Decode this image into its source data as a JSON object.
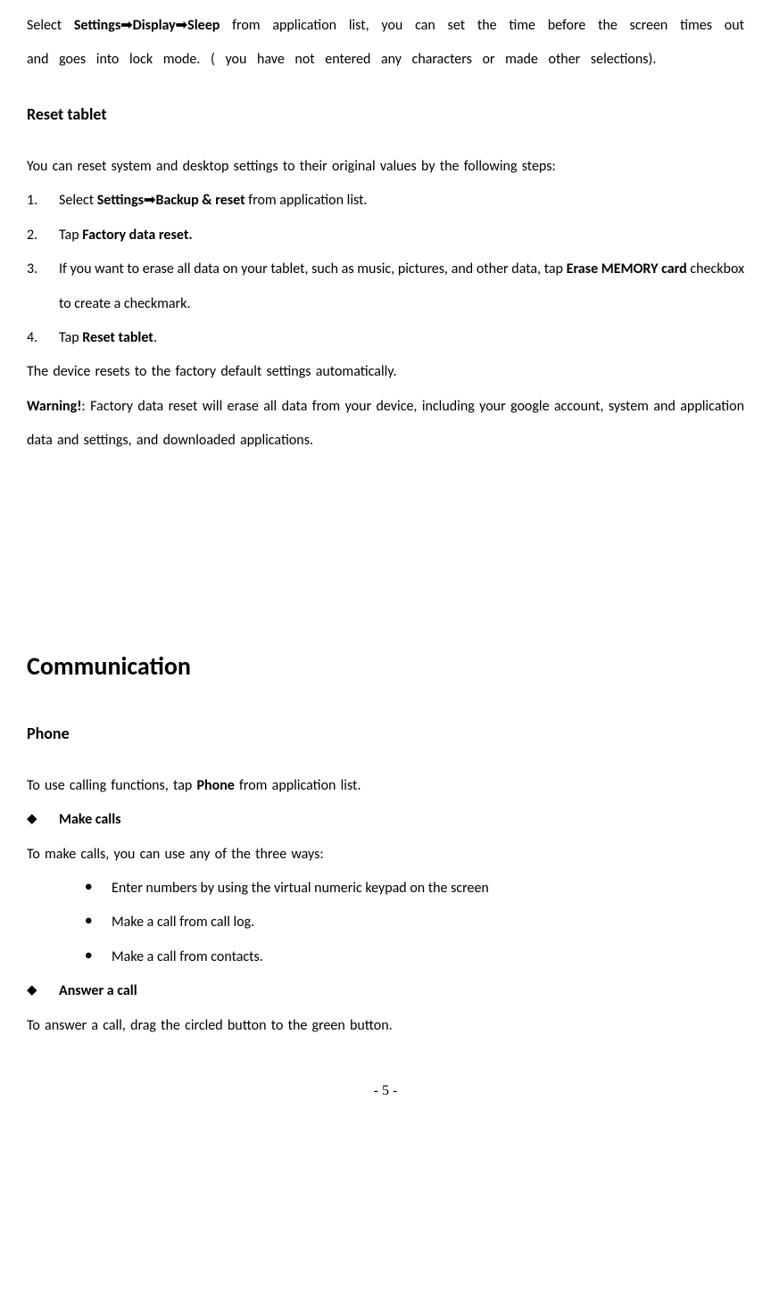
{
  "para1": {
    "pre": "Select ",
    "settings": "Settings",
    "display": "Display",
    "sleep": "Sleep",
    "post": " from application list, you can set the time before the screen times out and goes into lock mode. ( you have not entered any characters or made other selections)."
  },
  "heading_reset": "Reset tablet",
  "reset_intro": "You can reset system and desktop settings to their original values by the following steps:",
  "steps": {
    "s1": {
      "num": "1.",
      "pre": "Select ",
      "bold": "Settings",
      "mid": "Backup & reset",
      "post": " from application list."
    },
    "s2": {
      "num": "2.",
      "pre": "Tap ",
      "bold": "Factory data reset."
    },
    "s3": {
      "num": "3.",
      "pre": "If you want to erase all data on your tablet, such as music, pictures, and other data, tap ",
      "bold1": "Erase MEMORY card",
      "post": " checkbox to create a checkmark."
    },
    "s4": {
      "num": "4.",
      "pre": "Tap ",
      "bold": "Reset tablet",
      "post": "."
    }
  },
  "reset_outro": "The device resets to the factory default settings automatically.",
  "warning": {
    "label": "Warning!",
    "text": ": Factory data reset will erase all data from your device, including your google account, system and application data and settings, and downloaded applications."
  },
  "heading_comm": "Communication",
  "heading_phone": "Phone",
  "phone_intro_pre": "To use calling functions, tap ",
  "phone_intro_bold": "Phone",
  "phone_intro_post": " from application list.",
  "make_calls_heading": "Make calls",
  "make_calls_intro": "To make calls, you can use any of the three ways:",
  "make_calls_items": {
    "i1": "Enter numbers by using the virtual numeric keypad on the screen",
    "i2": "Make a call from call log.",
    "i3": "Make a call from contacts."
  },
  "answer_heading": "Answer a call",
  "answer_text": "To answer a call, drag the circled button to the green button.",
  "page_number": "- 5 -",
  "arrow_glyph": "➟"
}
